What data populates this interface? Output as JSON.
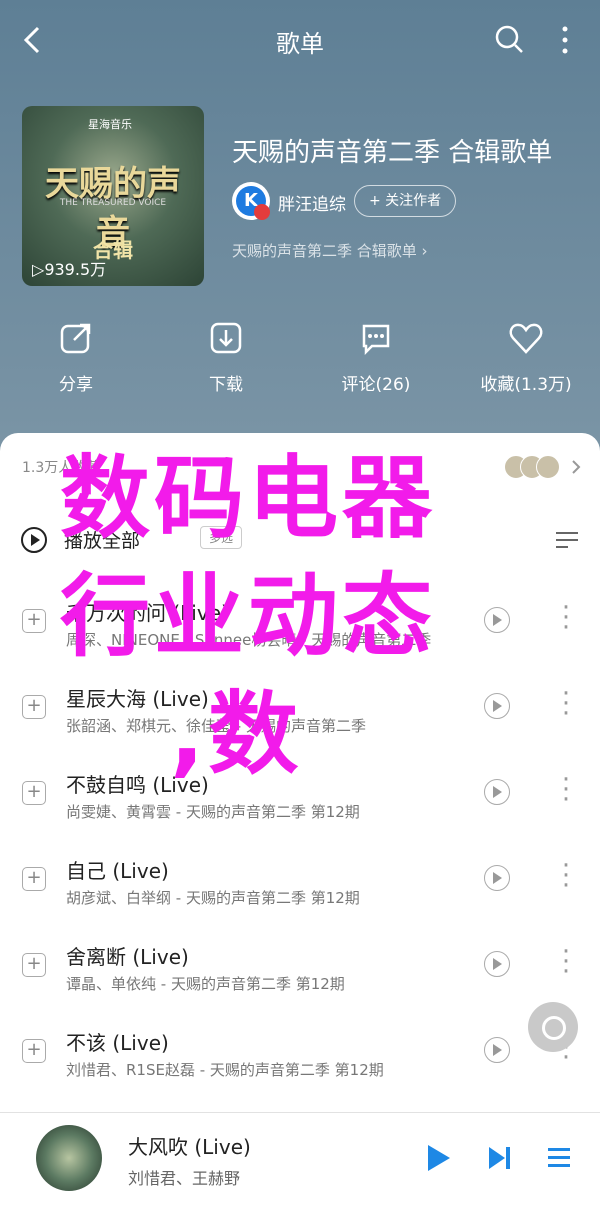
{
  "header": {
    "title": "歌单"
  },
  "playlist": {
    "cover": {
      "brand": "星海音乐",
      "title": "天赐的声音",
      "subtitle": "THE TREASURED VOICE",
      "tag": "合辑",
      "plays": "939.5万"
    },
    "title": "天赐的声音第二季 合辑歌单",
    "creator": {
      "name": "胖汪追综",
      "follow_label": "+ 关注作者"
    },
    "description": "天赐的声音第二季 合辑歌单 ›"
  },
  "actions": [
    {
      "label": "分享",
      "icon": "share-icon"
    },
    {
      "label": "下载",
      "icon": "download-icon"
    },
    {
      "label": "评论(26)",
      "icon": "comment-icon"
    },
    {
      "label": "收藏(1.3万)",
      "icon": "heart-icon"
    }
  ],
  "favorites": {
    "text": "1.3万人收藏"
  },
  "play_all": {
    "label": "播放全部",
    "count": "",
    "multi_label": "多选"
  },
  "songs": [
    {
      "name": "千万次的问 (Live)",
      "meta": "周深、NINEONE、Sunnee杨芸晴 - 天赐的声音第二季"
    },
    {
      "name": "星辰大海 (Live)",
      "meta": "张韶涵、郑棋元、徐佳莹 - 天赐的声音第二季"
    },
    {
      "name": "不鼓自鸣 (Live)",
      "meta": "尚雯婕、黄霄雲 - 天赐的声音第二季 第12期"
    },
    {
      "name": "自己 (Live)",
      "meta": "胡彦斌、白举纲 - 天赐的声音第二季 第12期"
    },
    {
      "name": "舍离断 (Live)",
      "meta": "谭晶、单依纯 - 天赐的声音第二季 第12期"
    },
    {
      "name": "不该 (Live)",
      "meta": "刘惜君、R1SE赵磊 - 天赐的声音第二季 第12期"
    }
  ],
  "player": {
    "song": "大风吹 (Live)",
    "artist": "刘惜君、王赫野"
  },
  "overlay": {
    "text1": "数码电器",
    "text2": "行业动态",
    "text3": ",数"
  },
  "colors": {
    "hero": "#6a889c",
    "overlay": "#f21bea",
    "player_accent": "#1e88e5"
  }
}
